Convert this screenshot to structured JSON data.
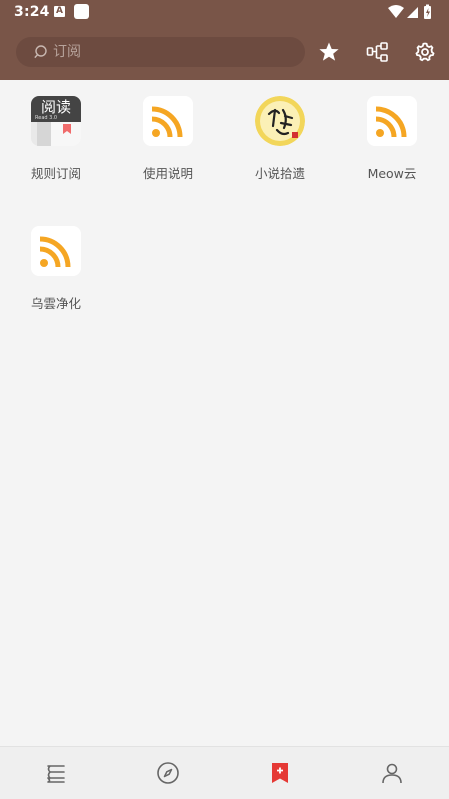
{
  "status_bar": {
    "time": "3:24",
    "notification_letter": "A"
  },
  "app_bar": {
    "search": {
      "placeholder": "订阅",
      "value": ""
    },
    "icons": [
      "star-icon",
      "group-icon",
      "settings-icon"
    ]
  },
  "sources": [
    {
      "label": "规则订阅",
      "icon": "reading-logo-icon",
      "logo_text": "阅读",
      "logo_sub": "Read 3.0"
    },
    {
      "label": "使用说明",
      "icon": "rss-icon"
    },
    {
      "label": "小说拾遗",
      "icon": "novel-seal-icon"
    },
    {
      "label": "Meow云",
      "icon": "rss-icon"
    },
    {
      "label": "乌雲净化",
      "icon": "rss-icon"
    }
  ],
  "bottom_nav": [
    {
      "name": "bookshelf",
      "icon": "bookshelf-icon"
    },
    {
      "name": "explore",
      "icon": "compass-icon"
    },
    {
      "name": "subscription",
      "icon": "rss-bookmark-icon",
      "active": true
    },
    {
      "name": "profile",
      "icon": "person-icon"
    }
  ],
  "colors": {
    "primary": "#795548",
    "accent": "#e53935",
    "rss_orange": "#f5a623",
    "background": "#f4f4f4"
  }
}
